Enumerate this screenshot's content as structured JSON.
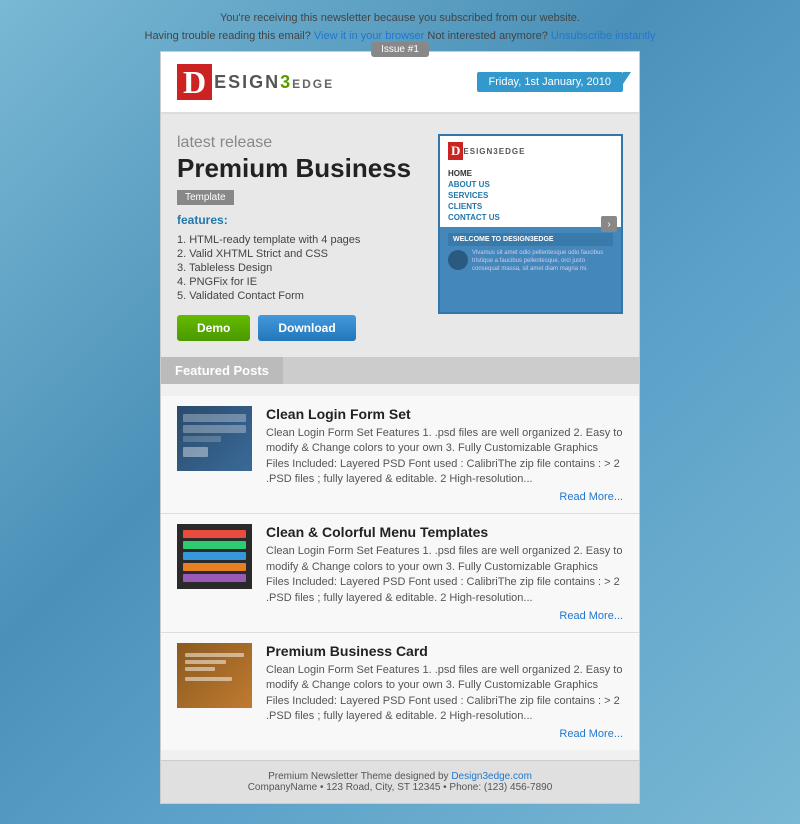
{
  "topbar": {
    "line1": "You're receiving this newsletter because you subscribed from our website.",
    "line2_before": "Having trouble reading this email?",
    "view_link": "View it in your browser",
    "line2_mid": "Not interested anymore?",
    "unsub_link": "Unsubscribe instantly"
  },
  "issue_badge": "Issue #1",
  "header": {
    "logo_d": "D",
    "logo_text": "ESIGN",
    "logo_num": "3",
    "logo_suffix": "EDGE",
    "date": "Friday, 1st January, 2010"
  },
  "feature": {
    "latest": "latest release",
    "title": "Premium Business",
    "template_label": "Template",
    "subtitle": "features:",
    "list": [
      "1. HTML-ready template with 4 pages",
      "2. Valid XHTML Strict and CSS",
      "3. Tableless Design",
      "4. PNGFix for IE",
      "5. Validated Contact Form"
    ],
    "btn_demo": "Demo",
    "btn_download": "Download"
  },
  "screenshot": {
    "logo_d": "D",
    "logo_text": "ESIGN3EDGE",
    "nav": [
      "HOME",
      "ABOUT US",
      "SERVICES",
      "CLIENTS",
      "CONTACT US"
    ],
    "welcome": "WELCOME TO DESIGN3EDGE",
    "body_text": "Vivamus sit amet odio pellentesque odio faucibus tristique a faucibus pellentesque, orci justo consequat massa, sit amet diam magna mi."
  },
  "featured_posts": {
    "header": "Featured Posts",
    "posts": [
      {
        "title": "Clean Login Form Set",
        "desc": "Clean Login Form Set Features 1. .psd files are well organized 2. Easy to modify & Change colors to your own 3. Fully Customizable Graphics Files Included: Layered PSD Font used : CalibriThe zip file contains : > 2 .PSD files ; fully layered & editable. 2 High-resolution...",
        "read_more": "Read More..."
      },
      {
        "title": "Clean & Colorful Menu Templates",
        "desc": "Clean Login Form Set Features 1. .psd files are well organized 2. Easy to modify & Change colors to your own 3. Fully Customizable Graphics Files Included: Layered PSD Font used : CalibriThe zip file contains : > 2 .PSD files ; fully layered & editable. 2 High-resolution...",
        "read_more": "Read More..."
      },
      {
        "title": "Premium Business Card",
        "desc": "Clean Login Form Set Features 1. .psd files are well organized 2. Easy to modify & Change colors to your own 3. Fully Customizable Graphics Files Included: Layered PSD Font used : CalibriThe zip file contains : > 2 .PSD files ; fully layered & editable. 2 High-resolution...",
        "read_more": "Read More..."
      }
    ]
  },
  "footer": {
    "line1_before": "Premium Newsletter Theme designed by",
    "design_link": "Design3edge.com",
    "line2": "CompanyName • 123 Road, City, ST 12345 • Phone: (123) 456-7890"
  }
}
